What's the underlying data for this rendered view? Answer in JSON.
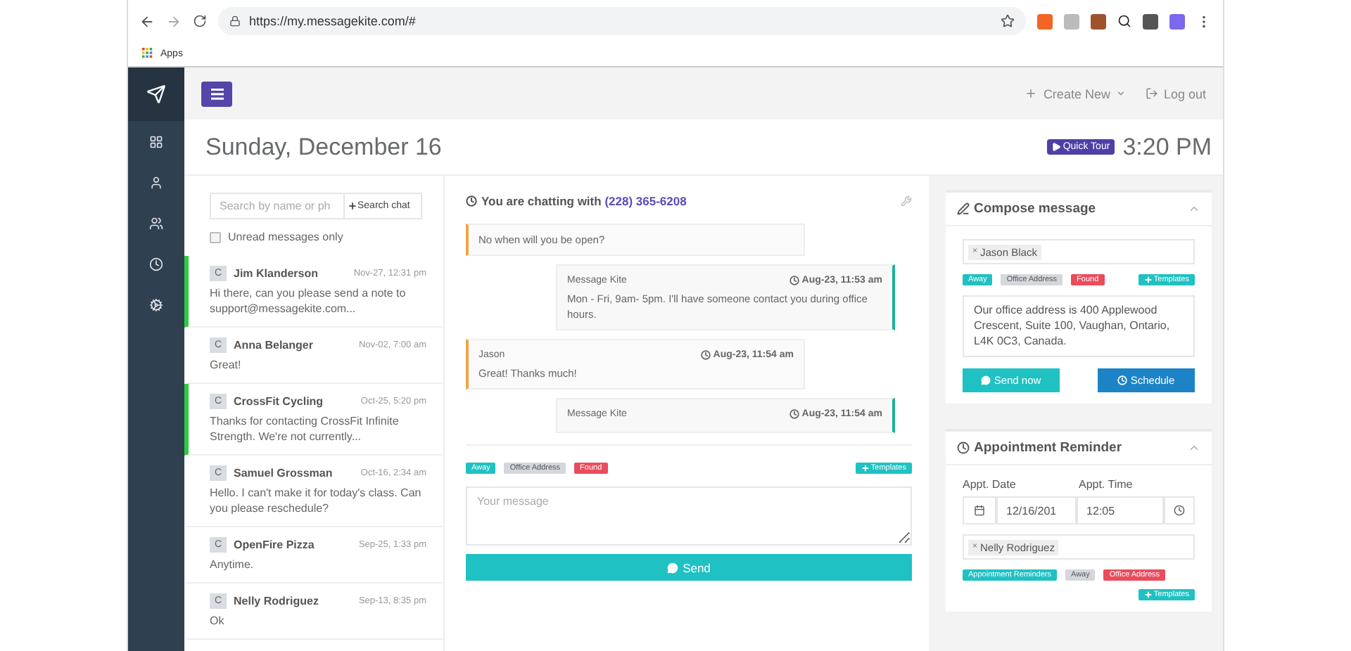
{
  "browser": {
    "url": "https://my.messagekite.com/#",
    "bookmarks": [
      {
        "label": "Apps"
      }
    ]
  },
  "sidebar": {
    "items": [
      {
        "kind": "dashboard"
      },
      {
        "kind": "contact"
      },
      {
        "kind": "groups"
      },
      {
        "kind": "history"
      },
      {
        "kind": "settings"
      }
    ]
  },
  "topbar": {
    "create_new": "Create New",
    "logout": "Log out"
  },
  "header": {
    "date": "Sunday, December 16",
    "quick_tour": "Quick Tour",
    "time": "3:20 PM"
  },
  "chat_list": {
    "search": {
      "placeholder": "Search by name or ph"
    },
    "search_button": "Search chat",
    "unread_filter": {
      "label": "Unread messages only",
      "checked": false
    },
    "items": [
      {
        "avatar": "C",
        "name": "Jim Klanderson",
        "time": "Nov-27, 12:31 pm",
        "preview": "Hi there, can you please send a note to support@messagekite.com...",
        "unread": true
      },
      {
        "avatar": "C",
        "name": "Anna Belanger",
        "time": "Nov-02, 7:00 am",
        "preview": "Great!",
        "unread": false
      },
      {
        "avatar": "C",
        "name": "CrossFit Cycling",
        "time": "Oct-25, 5:20 pm",
        "preview": "Thanks for contacting CrossFit Infinite Strength. We're not currently...",
        "unread": true
      },
      {
        "avatar": "C",
        "name": "Samuel Grossman",
        "time": "Oct-16, 2:34 am",
        "preview": "Hello. I can't make it for today's class. Can you please reschedule?",
        "unread": false
      },
      {
        "avatar": "C",
        "name": "OpenFire Pizza",
        "time": "Sep-25, 1:33 pm",
        "preview": "Anytime.",
        "unread": false
      },
      {
        "avatar": "C",
        "name": "Nelly Rodriguez",
        "time": "Sep-13, 8:35 pm",
        "preview": "Ok",
        "unread": false
      }
    ]
  },
  "chat": {
    "title": "You are chatting with",
    "phone": "(228) 365-6208",
    "messages": [
      {
        "kind": "incoming",
        "text": "No when will you be open?"
      },
      {
        "kind": "outgoing",
        "sender": "Message Kite",
        "time": "Aug-23, 11:53 am",
        "text": "Mon - Fri, 9am- 5pm. I'll have someone contact you during office hours."
      },
      {
        "kind": "incoming",
        "sender": "Jason",
        "time": "Aug-23, 11:54 am",
        "text": "Great! Thanks much!"
      },
      {
        "kind": "outgoing",
        "sender": "Message Kite",
        "time": "Aug-23, 11:54 am"
      }
    ],
    "tags": [
      {
        "label": "Away",
        "color": "#1fc1c3"
      },
      {
        "label": "Office Address",
        "color": "#d4d8dd"
      },
      {
        "label": "Found",
        "color": "#ea4c5c"
      }
    ],
    "templates": "Templates",
    "message": {
      "placeholder": "Your message"
    },
    "send": "Send"
  },
  "compose": {
    "title": "Compose message",
    "expanded": true,
    "recipients": [
      {
        "name": "Jason Black",
        "remove": "×"
      }
    ],
    "tags": [
      {
        "label": "Away",
        "color": "#1fc1c3"
      },
      {
        "label": "Office Address",
        "color": "#d4d8dd"
      },
      {
        "label": "Found",
        "color": "#ea4c5c"
      }
    ],
    "templates": "Templates",
    "text": "Our office address is 400 Applewood Crescent, Suite 100, Vaughan, Ontario, L4K 0C3, Canada.",
    "send_now": "Send now",
    "schedule": "Schedule"
  },
  "appointment": {
    "title": "Appointment Reminder",
    "expanded": true,
    "date_label": "Appt. Date",
    "time_label": "Appt. Time",
    "date": "12/16/201",
    "time": "12:05",
    "recipients": [
      {
        "name": "Nelly Rodriguez",
        "remove": "×"
      }
    ],
    "tags": [
      {
        "label": "Appointment Reminders",
        "color": "#1fc1c3"
      },
      {
        "label": "Away",
        "color": "#d4d8dd"
      },
      {
        "label": "Office Address",
        "color": "#ea4c5c"
      }
    ],
    "templates": "Templates"
  }
}
